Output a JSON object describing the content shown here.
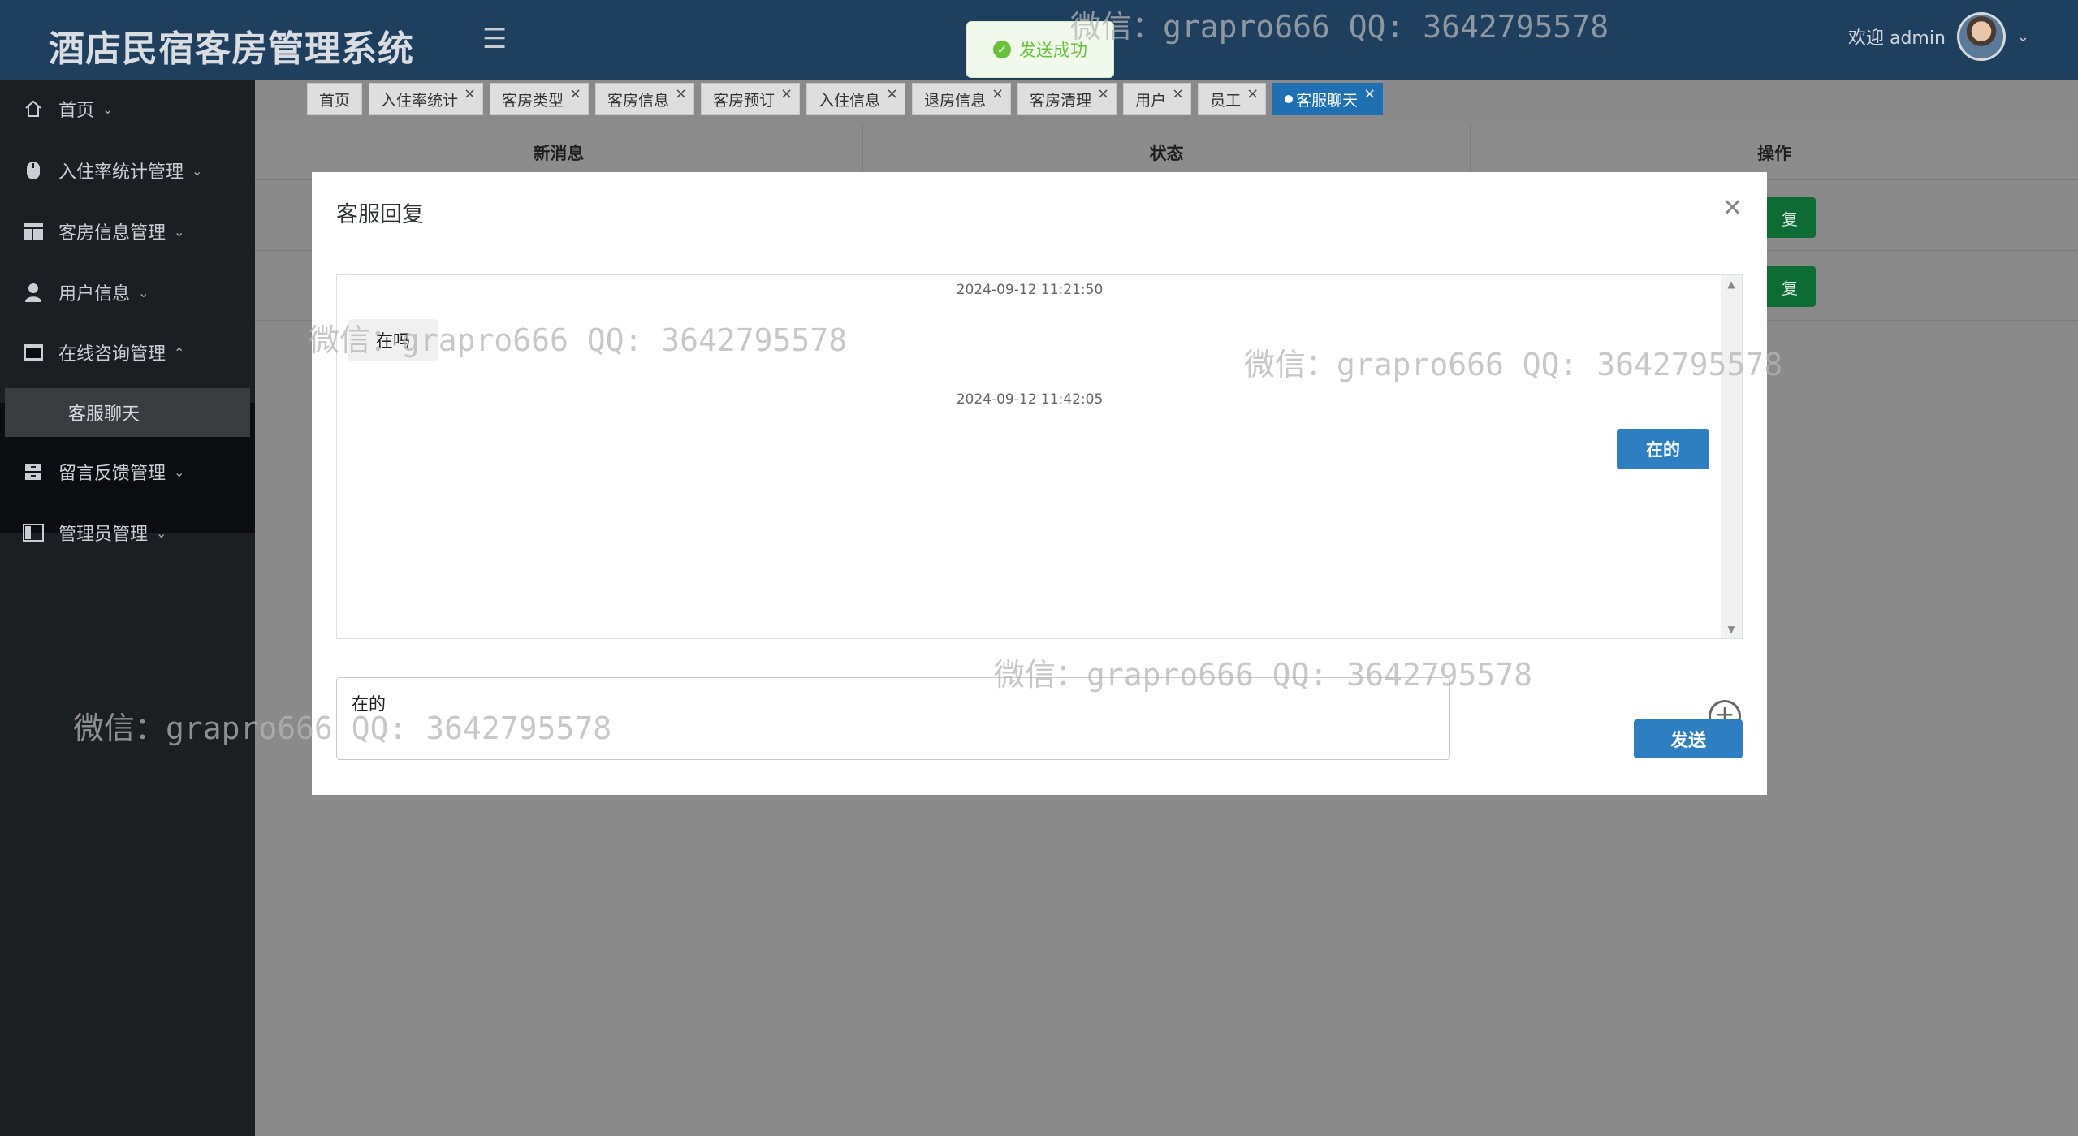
{
  "header": {
    "brand": "酒店民宿客房管理系统",
    "welcome": "欢迎 admin"
  },
  "sidebar": {
    "items": [
      {
        "label": "首页",
        "icon": "home-icon",
        "arrow": "⌄"
      },
      {
        "label": "入住率统计管理",
        "icon": "mouse-icon",
        "arrow": "⌄"
      },
      {
        "label": "客房信息管理",
        "icon": "layout-icon",
        "arrow": "⌄"
      },
      {
        "label": "用户信息",
        "icon": "user-icon",
        "arrow": "⌄"
      },
      {
        "label": "在线咨询管理",
        "icon": "window-icon",
        "arrow": "⌃"
      },
      {
        "label": "留言反馈管理",
        "icon": "storage-icon",
        "arrow": "⌄"
      },
      {
        "label": "管理员管理",
        "icon": "sidebar-panel-icon",
        "arrow": "⌄"
      }
    ],
    "sub_item": "客服聊天"
  },
  "tabs": [
    {
      "label": "首页",
      "closable": false
    },
    {
      "label": "入住率统计",
      "closable": true
    },
    {
      "label": "客房类型",
      "closable": true
    },
    {
      "label": "客房信息",
      "closable": true
    },
    {
      "label": "客房预订",
      "closable": true
    },
    {
      "label": "入住信息",
      "closable": true
    },
    {
      "label": "退房信息",
      "closable": true
    },
    {
      "label": "客房清理",
      "closable": true
    },
    {
      "label": "用户",
      "closable": true
    },
    {
      "label": "员工",
      "closable": true
    },
    {
      "label": "客服聊天",
      "closable": true,
      "active": true
    }
  ],
  "table": {
    "headers": [
      "新消息",
      "状态",
      "操作"
    ],
    "row_buttons": [
      "复",
      "复"
    ]
  },
  "toast": {
    "message": "发送成功",
    "color": "#67c23a"
  },
  "dialog": {
    "title": "客服回复",
    "messages": [
      {
        "time": "2024-09-12 11:21:50",
        "text": "在吗",
        "side": "left"
      },
      {
        "time": "2024-09-12 11:42:05",
        "text": "在的",
        "side": "right"
      }
    ],
    "input_value": "在的",
    "send_label": "发送"
  },
  "watermark": "微信：grapro666 QQ: 3642795578",
  "colors": {
    "header_bg": "#1f3f5f",
    "sidebar_bg": "#1c1f22",
    "primary": "#2d7fc1",
    "reply_green": "#0d6b34"
  }
}
